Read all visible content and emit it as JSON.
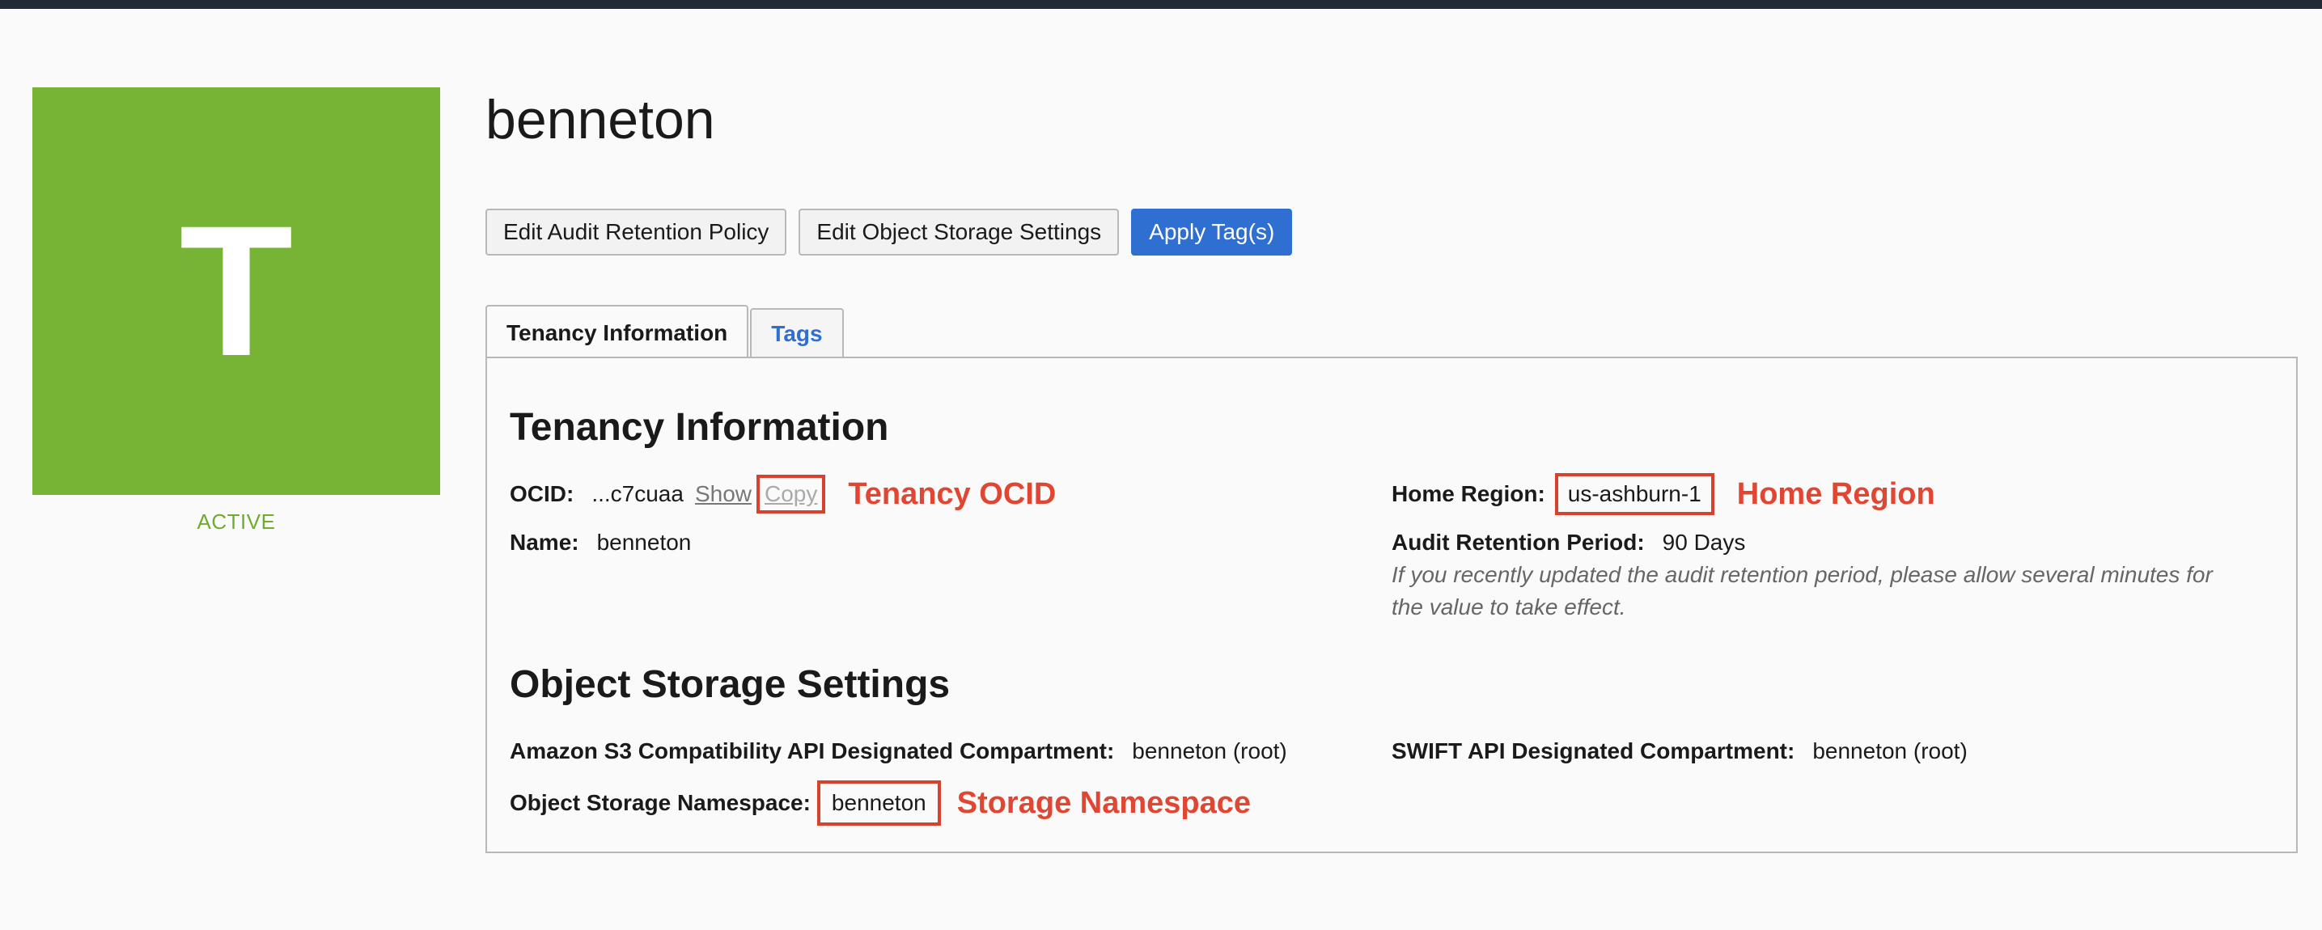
{
  "tenancy": {
    "initial": "T",
    "status": "ACTIVE",
    "name": "benneton"
  },
  "actions": {
    "edit_audit": "Edit Audit Retention Policy",
    "edit_storage": "Edit Object Storage Settings",
    "apply_tags": "Apply Tag(s)"
  },
  "tabs": [
    {
      "label": "Tenancy Information",
      "active": true
    },
    {
      "label": "Tags",
      "active": false
    }
  ],
  "info": {
    "title": "Tenancy Information",
    "ocid_label": "OCID:",
    "ocid_value": "...c7cuaa",
    "show": "Show",
    "copy": "Copy",
    "ocid_annotation": "Tenancy OCID",
    "name_label": "Name:",
    "name_value": "benneton",
    "home_region_label": "Home Region:",
    "home_region_value": "us-ashburn-1",
    "home_region_annotation": "Home Region",
    "audit_label": "Audit Retention Period:",
    "audit_value": "90 Days",
    "audit_note_1": "If you recently updated the audit retention period, please allow several minutes for",
    "audit_note_2": "the value to take effect."
  },
  "storage": {
    "title": "Object Storage Settings",
    "s3_label": "Amazon S3 Compatibility API Designated Compartment:",
    "s3_value": "benneton (root)",
    "swift_label": "SWIFT API Designated Compartment:",
    "swift_value": "benneton (root)",
    "namespace_label": "Object Storage Namespace:",
    "namespace_value": "benneton",
    "namespace_annotation": "Storage Namespace"
  },
  "colors": {
    "avatar": "#77b334",
    "primary": "#2e6fd1",
    "annotation": "#e04632"
  }
}
